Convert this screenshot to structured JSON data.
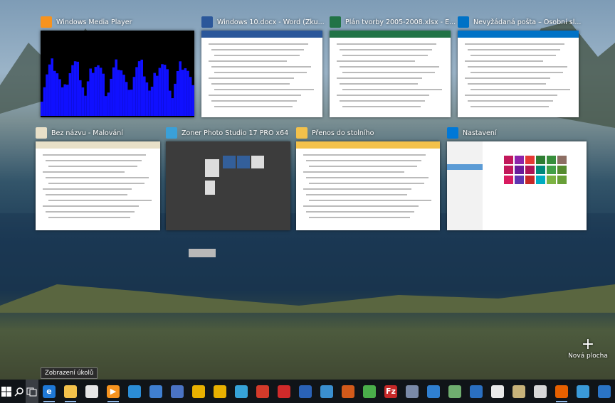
{
  "windows": [
    {
      "title": "Windows Media Player",
      "icon": "media-player-icon",
      "color": "#f7931e"
    },
    {
      "title": "Windows 10.docx - Word (Zku...",
      "icon": "word-icon",
      "color": "#2b579a"
    },
    {
      "title": "Plán tvorby 2005-2008.xlsx - E...",
      "icon": "excel-icon",
      "color": "#217346"
    },
    {
      "title": "Nevyžádaná pošta – Osobní sl...",
      "icon": "outlook-icon",
      "color": "#0072c6"
    },
    {
      "title": "Bez názvu - Malování",
      "icon": "paint-icon",
      "color": "#e8e0c8"
    },
    {
      "title": "Zoner Photo Studio 17 PRO x64",
      "icon": "zoner-icon",
      "color": "#3aa0d8"
    },
    {
      "title": "Přenos do stolního",
      "icon": "folder-icon",
      "color": "#f3c14b"
    },
    {
      "title": "Nastavení",
      "icon": "settings-icon",
      "color": "#0078d7"
    }
  ],
  "new_desktop_label": "Nová plocha",
  "tooltip": "Zobrazení úkolů",
  "taskbar": {
    "start_icon": "windows-start-icon",
    "search_icon": "search-icon",
    "task_view_icon": "task-view-icon",
    "pinned": [
      {
        "name": "edge-icon",
        "color": "#1e78d6",
        "glyph": "e"
      },
      {
        "name": "explorer-icon",
        "color": "#f3c14b",
        "glyph": ""
      },
      {
        "name": "store-icon",
        "color": "#e6e6e6",
        "glyph": ""
      },
      {
        "name": "media-player-icon",
        "color": "#f7931e",
        "glyph": "▶"
      },
      {
        "name": "image-editor-icon",
        "color": "#2b8dd6",
        "glyph": ""
      },
      {
        "name": "globe-icon",
        "color": "#3f7fd0",
        "glyph": ""
      },
      {
        "name": "save-icon",
        "color": "#4a73c4",
        "glyph": ""
      },
      {
        "name": "yellow-app-icon",
        "color": "#e8b000",
        "glyph": ""
      },
      {
        "name": "yellow-app2-icon",
        "color": "#e8b000",
        "glyph": ""
      },
      {
        "name": "puzzle-icon",
        "color": "#36a3d8",
        "glyph": ""
      },
      {
        "name": "red-app-icon",
        "color": "#d43a2a",
        "glyph": ""
      },
      {
        "name": "red-oval-icon",
        "color": "#d02a2a",
        "glyph": ""
      },
      {
        "name": "blue-app-icon",
        "color": "#2a62b6",
        "glyph": ""
      },
      {
        "name": "diamond-icon",
        "color": "#3a8fcf",
        "glyph": ""
      },
      {
        "name": "orange-app-icon",
        "color": "#d35a1a",
        "glyph": ""
      },
      {
        "name": "green-circle-icon",
        "color": "#4aae4a",
        "glyph": ""
      },
      {
        "name": "filezilla-icon",
        "color": "#c62828",
        "glyph": "Fz"
      },
      {
        "name": "cube-icon",
        "color": "#7a8aa8",
        "glyph": ""
      },
      {
        "name": "tool-icon",
        "color": "#2f7fd0",
        "glyph": ""
      },
      {
        "name": "feather-icon",
        "color": "#6fae6f",
        "glyph": ""
      },
      {
        "name": "book-icon",
        "color": "#2a6fc0",
        "glyph": ""
      },
      {
        "name": "notepad-icon",
        "color": "#e9e9e9",
        "glyph": ""
      },
      {
        "name": "library-icon",
        "color": "#c8b37a",
        "glyph": ""
      },
      {
        "name": "photo-icon",
        "color": "#d8d8d8",
        "glyph": ""
      },
      {
        "name": "firefox-icon",
        "color": "#e66000",
        "glyph": ""
      },
      {
        "name": "shield-icon",
        "color": "#3a9ad9",
        "glyph": ""
      },
      {
        "name": "arrow-icon",
        "color": "#2a74c6",
        "glyph": ""
      }
    ]
  }
}
